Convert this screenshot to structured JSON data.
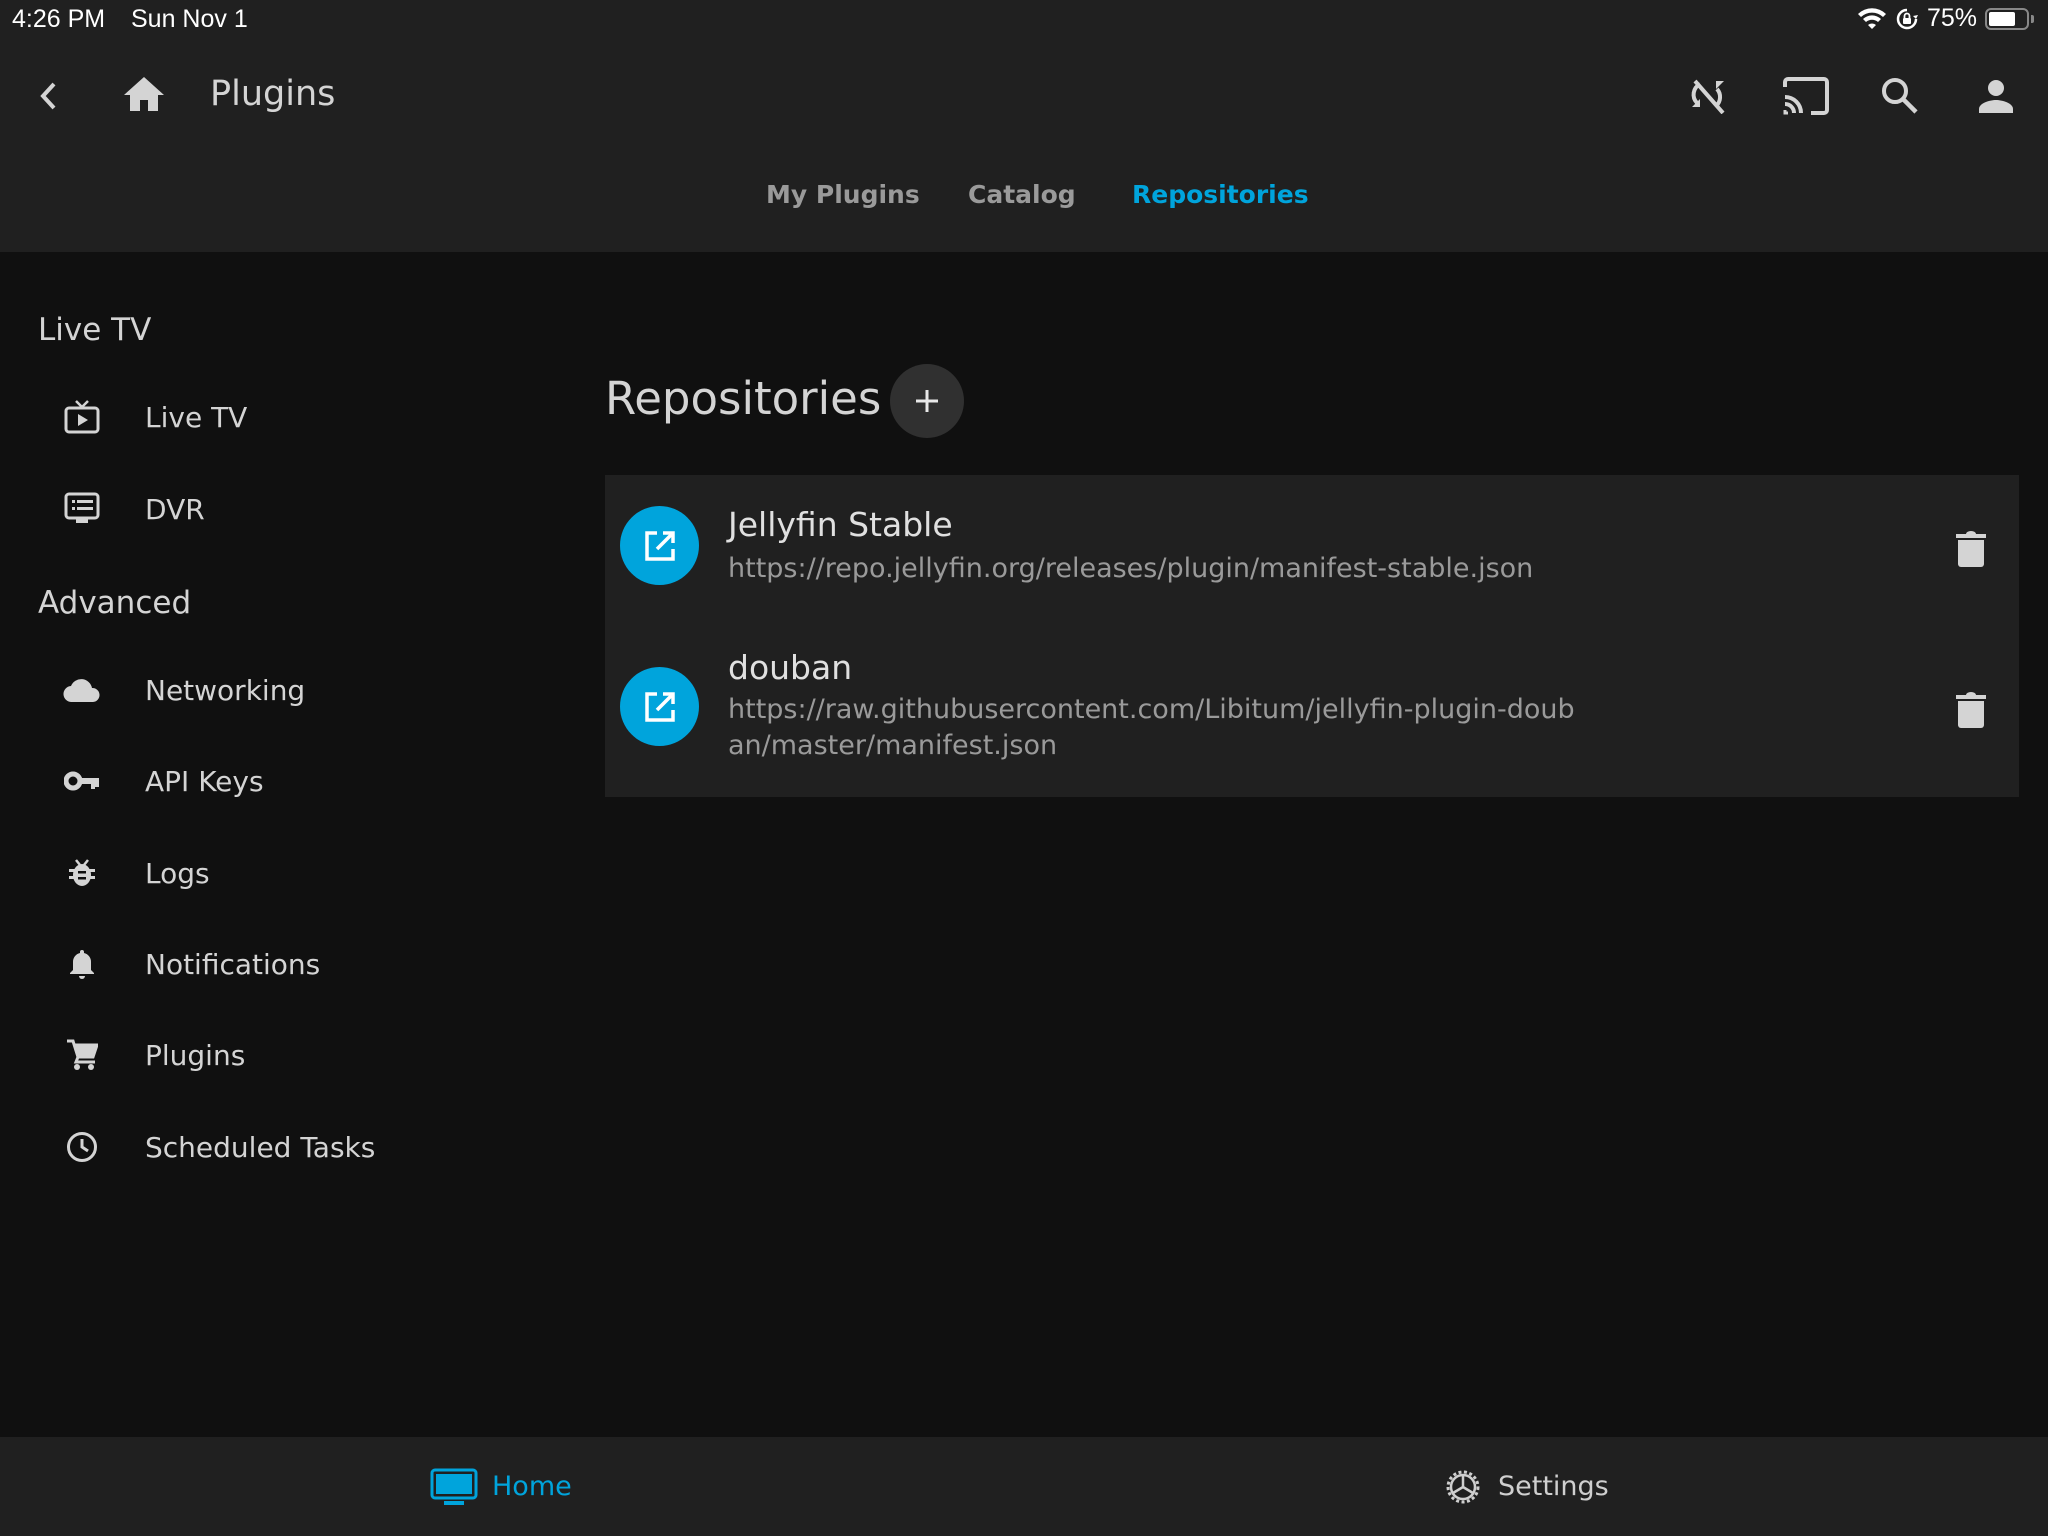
{
  "status_bar": {
    "time": "4:26 PM",
    "date": "Sun Nov 1",
    "battery_text": "75%",
    "battery_level": 0.75,
    "icons": [
      "wifi-icon",
      "orientation-lock-icon",
      "battery-icon"
    ]
  },
  "header": {
    "title": "Plugins",
    "left_icons": [
      "back-arrow-icon",
      "home-icon"
    ],
    "right_icons": [
      "sync-disabled-icon",
      "cast-icon",
      "search-icon",
      "user-icon"
    ]
  },
  "tabs": [
    {
      "label": "My Plugins",
      "active": false
    },
    {
      "label": "Catalog",
      "active": false
    },
    {
      "label": "Repositories",
      "active": true
    }
  ],
  "sidebar": {
    "sections": [
      {
        "heading": "Live TV",
        "items": [
          {
            "label": "Live TV",
            "icon": "live-tv-icon"
          },
          {
            "label": "DVR",
            "icon": "dvr-icon"
          }
        ]
      },
      {
        "heading": "Advanced",
        "items": [
          {
            "label": "Networking",
            "icon": "cloud-icon"
          },
          {
            "label": "API Keys",
            "icon": "key-icon"
          },
          {
            "label": "Logs",
            "icon": "bug-icon"
          },
          {
            "label": "Notifications",
            "icon": "bell-icon"
          },
          {
            "label": "Plugins",
            "icon": "cart-icon"
          },
          {
            "label": "Scheduled Tasks",
            "icon": "clock-icon"
          }
        ]
      }
    ]
  },
  "main": {
    "title": "Repositories",
    "add_button_label": "+",
    "repositories": [
      {
        "name": "Jellyfin Stable",
        "url": "https://repo.jellyfin.org/releases/plugin/manifest-stable.json"
      },
      {
        "name": "douban",
        "url": "https://raw.githubusercontent.com/Libitum/jellyfin-plugin-douban/master/manifest.json"
      }
    ]
  },
  "bottom_nav": {
    "items": [
      {
        "label": "Home",
        "icon": "tv-icon",
        "active": true
      },
      {
        "label": "Settings",
        "icon": "gear-icon",
        "active": false
      }
    ]
  },
  "colors": {
    "accent": "#00a4dc",
    "header_bg": "#202020",
    "page_bg": "#101010",
    "card_bg": "#202020"
  }
}
